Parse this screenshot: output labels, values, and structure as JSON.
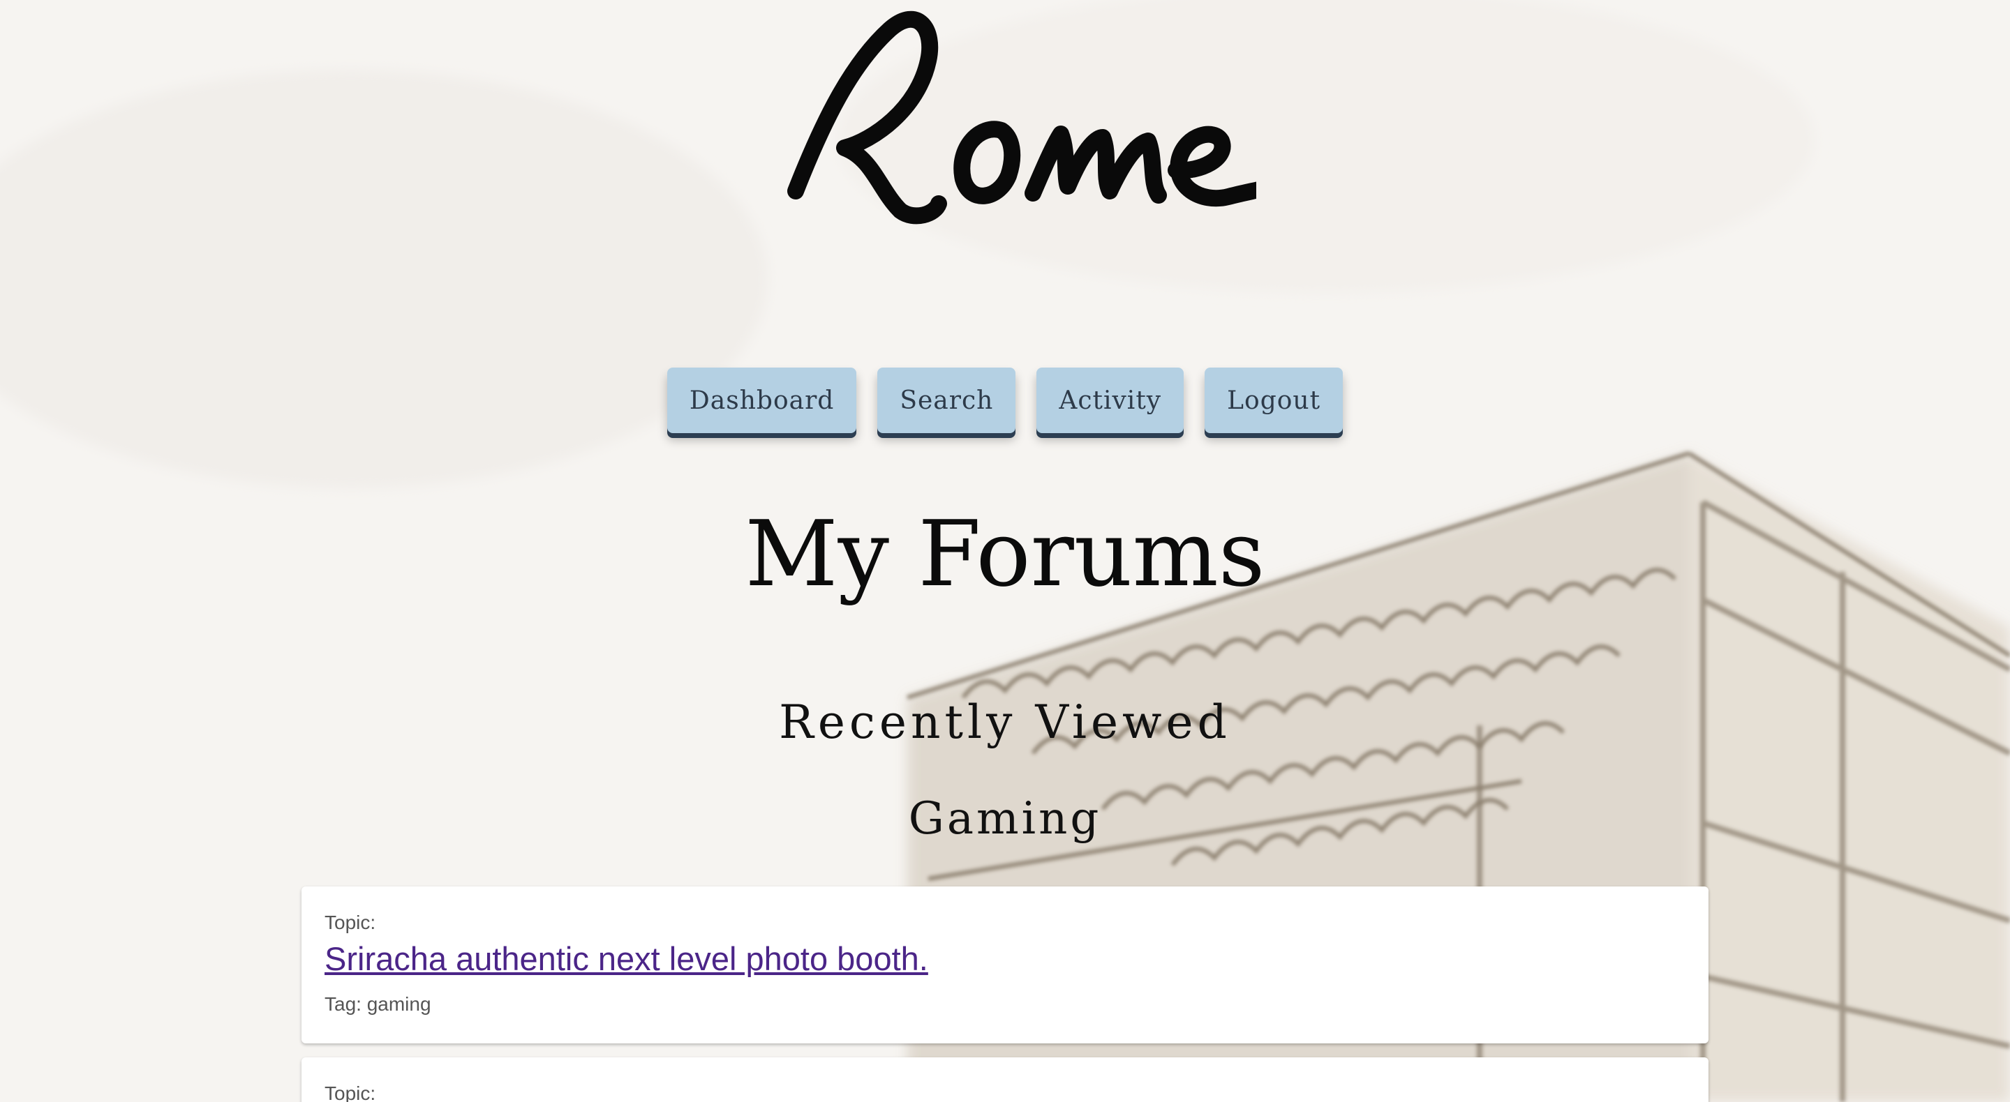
{
  "site": {
    "logo_text": "Rome"
  },
  "nav": {
    "dashboard": "Dashboard",
    "search": "Search",
    "activity": "Activity",
    "logout": "Logout"
  },
  "page": {
    "title": "My Forums",
    "section_title": "Recently Viewed",
    "forum_name": "Gaming"
  },
  "cards": [
    {
      "topic_label": "Topic:",
      "topic_title": "Sriracha authentic next level photo booth.",
      "tag_label": "Tag: gaming"
    },
    {
      "topic_label": "Topic:"
    }
  ],
  "colors": {
    "nav_button_bg": "#b4d0e3",
    "nav_button_shadow": "#2c3e52",
    "link": "#4b2588",
    "background": "#f7f5f2"
  }
}
